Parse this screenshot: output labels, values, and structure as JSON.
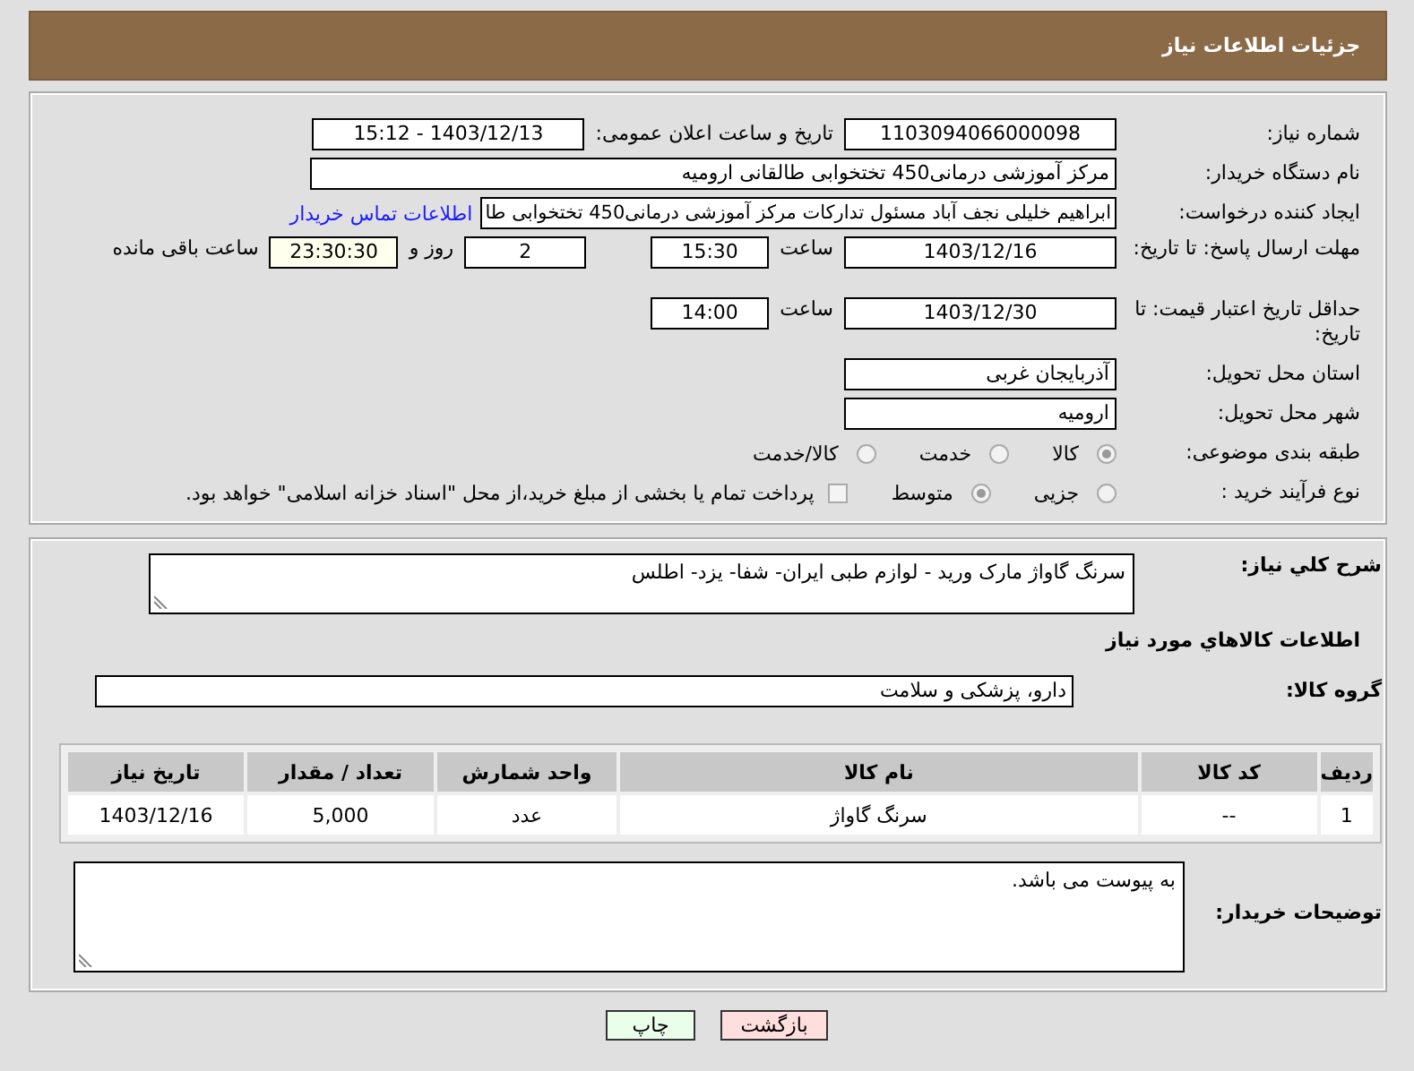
{
  "header": {
    "title": "جزئیات اطلاعات نیاز"
  },
  "details": {
    "need_number": {
      "label": "شماره نیاز:",
      "value": "1103094066000098"
    },
    "announce": {
      "label": "تاریخ و ساعت اعلان عمومی:",
      "value": "1403/12/13 - 15:12"
    },
    "buyer": {
      "label": "نام دستگاه خریدار:",
      "value": "مرکز آموزشی درمانی450 تختخوابی طالقانی ارومیه"
    },
    "creator": {
      "label": "ایجاد کننده درخواست:",
      "value": "ابراهیم خلیلی نجف آباد مسئول تدارکات مرکز آموزشی درمانی450 تختخوابی طا",
      "link": "اطلاعات تماس خریدار"
    },
    "deadline": {
      "label": "مهلت ارسال پاسخ: تا تاریخ:",
      "date": "1403/12/16",
      "time_label": "ساعت",
      "time": "15:30",
      "days": "2",
      "days_label": "روز و",
      "remaining": "23:30:30",
      "remaining_label": "ساعت باقی مانده"
    },
    "validity": {
      "label": "حداقل تاریخ اعتبار قیمت: تا تاریخ:",
      "date": "1403/12/30",
      "time_label": "ساعت",
      "time": "14:00"
    },
    "province": {
      "label": "استان محل تحویل:",
      "value": "آذربایجان غربی"
    },
    "city": {
      "label": "شهر محل تحویل:",
      "value": "ارومیه"
    },
    "category": {
      "label": "طبقه بندی موضوعی:",
      "options": [
        {
          "label": "کالا",
          "selected": true
        },
        {
          "label": "خدمت",
          "selected": false
        },
        {
          "label": "کالا/خدمت",
          "selected": false
        }
      ]
    },
    "process": {
      "label": "نوع فرآیند خرید :",
      "options": [
        {
          "label": "جزیی",
          "selected": false
        },
        {
          "label": "متوسط",
          "selected": true
        }
      ],
      "payment": {
        "checked": false,
        "text": "پرداخت تمام یا بخشی از مبلغ خرید،از محل \"اسناد خزانه اسلامی\" خواهد بود."
      }
    }
  },
  "needs": {
    "summary": {
      "label": "شرح کلي نياز:",
      "value": "سرنگ گاواژ مارک ورید - لوازم طبی ایران- شفا- یزد- اطلس"
    },
    "heading": "اطلاعات کالاهاي مورد نياز",
    "group": {
      "label": "گروه کالا:",
      "value": "دارو، پزشکی و سلامت"
    },
    "table": {
      "columns": [
        "ردیف",
        "کد کالا",
        "نام کالا",
        "واحد شمارش",
        "تعداد / مقدار",
        "تاریخ نیاز"
      ],
      "rows": [
        [
          "1",
          "--",
          "سرنگ گاواژ",
          "عدد",
          "5,000",
          "1403/12/16"
        ]
      ]
    },
    "comments": {
      "label": "توضیحات خریدار:",
      "value": "به پیوست می باشد."
    }
  },
  "buttons": [
    {
      "kind": "back",
      "label": "بازگشت"
    },
    {
      "kind": "print",
      "label": "چاپ"
    }
  ]
}
